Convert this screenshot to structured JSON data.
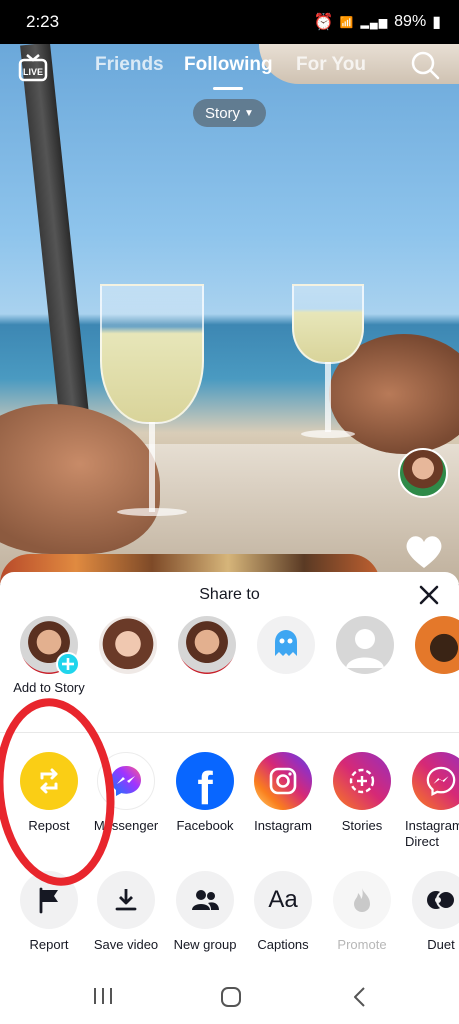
{
  "status": {
    "time": "2:23",
    "battery": "89%"
  },
  "top_nav": {
    "tabs": [
      {
        "label": "Friends",
        "active": false
      },
      {
        "label": "Following",
        "active": true
      },
      {
        "label": "For You",
        "active": false
      }
    ],
    "story_label": "Story",
    "live_icon": "live-icon",
    "search_icon": "search-icon"
  },
  "share_sheet": {
    "title": "Share to",
    "contacts": [
      {
        "label": "Add to Story",
        "icon": "plus-badge"
      },
      {
        "label": ""
      },
      {
        "label": ""
      },
      {
        "label": "",
        "icon": "ghost-app-icon"
      },
      {
        "label": "",
        "icon": "default-avatar-icon"
      },
      {
        "label": "",
        "icon": "cafe-logo"
      }
    ],
    "apps": [
      {
        "label": "Repost",
        "icon": "repost-icon",
        "color": "#FACE15"
      },
      {
        "label": "Messenger",
        "icon": "messenger-icon"
      },
      {
        "label": "Facebook",
        "icon": "facebook-icon",
        "color": "#0866FF"
      },
      {
        "label": "Instagram",
        "icon": "instagram-icon"
      },
      {
        "label": "Stories",
        "icon": "stories-icon"
      },
      {
        "label": "Instagram Direct",
        "icon": "instagram-direct-icon"
      }
    ],
    "actions": [
      {
        "label": "Report",
        "icon": "flag-icon",
        "disabled": false
      },
      {
        "label": "Save video",
        "icon": "download-icon",
        "disabled": false
      },
      {
        "label": "New group",
        "icon": "group-icon",
        "disabled": false
      },
      {
        "label": "Captions",
        "icon": "captions-icon",
        "disabled": false
      },
      {
        "label": "Promote",
        "icon": "flame-icon",
        "disabled": true
      },
      {
        "label": "Duet",
        "icon": "duet-icon",
        "disabled": false
      }
    ]
  },
  "colors": {
    "annotation_red": "#E8262D",
    "repost_yellow": "#FACE15",
    "facebook_blue": "#0866FF"
  }
}
